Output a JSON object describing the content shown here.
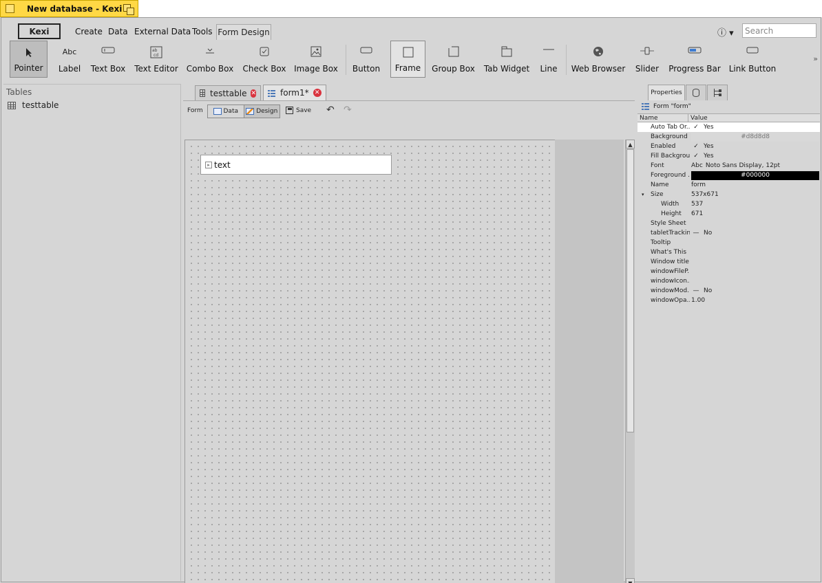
{
  "window": {
    "title": "New database - Kexi"
  },
  "menu": {
    "app_button": "Kexi",
    "tabs": [
      "Create",
      "Data",
      "External Data",
      "Tools",
      "Form Design"
    ],
    "search_placeholder": "Search"
  },
  "toolbar": {
    "tools": [
      {
        "label": "Pointer",
        "icon": "pointer-icon",
        "active": true
      },
      {
        "label": "Label",
        "icon": "label-abc-icon"
      },
      {
        "label": "Text Box",
        "icon": "textbox-icon"
      },
      {
        "label": "Text Editor",
        "icon": "text-editor-icon"
      },
      {
        "label": "Combo Box",
        "icon": "combobox-icon"
      },
      {
        "label": "Check Box",
        "icon": "checkbox-icon"
      },
      {
        "label": "Image Box",
        "icon": "image-icon"
      },
      {
        "label": "Button",
        "icon": "button-icon"
      },
      {
        "label": "Frame",
        "icon": "frame-icon",
        "highlighted": true
      },
      {
        "label": "Group Box",
        "icon": "groupbox-icon"
      },
      {
        "label": "Tab Widget",
        "icon": "tabwidget-icon"
      },
      {
        "label": "Line",
        "icon": "line-icon"
      },
      {
        "label": "Web Browser",
        "icon": "globe-icon"
      },
      {
        "label": "Slider",
        "icon": "slider-icon"
      },
      {
        "label": "Progress Bar",
        "icon": "progressbar-icon"
      },
      {
        "label": "Link Button",
        "icon": "link-button-icon"
      }
    ],
    "label_icon_text": "Abc",
    "more_glyph": "»"
  },
  "navigator": {
    "header": "Tables",
    "items": [
      {
        "label": "testtable",
        "icon": "table-grid-icon"
      }
    ]
  },
  "document_tabs": [
    {
      "label": "testtable",
      "icon": "table-grid-icon",
      "active": false
    },
    {
      "label": "form1*",
      "icon": "form-icon",
      "active": true
    }
  ],
  "view_toolbar": {
    "form_label": "Form",
    "data_label": "Data",
    "design_label": "Design",
    "save_label": "Save"
  },
  "form_canvas": {
    "widget_text": "text"
  },
  "properties": {
    "tabs": [
      "Properties"
    ],
    "object_title": "Form \"form\"",
    "col_name": "Name",
    "col_value": "Value",
    "rows": [
      {
        "name": "Auto Tab Or...",
        "check": "✓",
        "value": "Yes",
        "selected": true
      },
      {
        "name": "Background ...",
        "swatch": "#d8d8d8",
        "value": "#d8d8d8"
      },
      {
        "name": "Enabled",
        "check": "✓",
        "value": "Yes"
      },
      {
        "name": "Fill Backgrou...",
        "check": "✓",
        "value": "Yes"
      },
      {
        "name": "Font",
        "prefix": "Abc",
        "value": "Noto Sans Display, 12pt"
      },
      {
        "name": "Foreground ...",
        "swatch": "#000000",
        "value": "#000000"
      },
      {
        "name": "Name",
        "value": "form"
      },
      {
        "name": "Size",
        "value": "537x671",
        "expander": "▾"
      },
      {
        "name": "Width",
        "value": "537",
        "sub": true
      },
      {
        "name": "Height",
        "value": "671",
        "sub": true
      },
      {
        "name": "Style Sheet",
        "value": ""
      },
      {
        "name": "tabletTracking",
        "check": "—",
        "value": "No"
      },
      {
        "name": "Tooltip",
        "value": ""
      },
      {
        "name": "What's This",
        "value": ""
      },
      {
        "name": "Window title",
        "value": ""
      },
      {
        "name": "windowFileP...",
        "value": ""
      },
      {
        "name": "windowIcon...",
        "value": ""
      },
      {
        "name": "windowMod...",
        "check": "—",
        "value": "No"
      },
      {
        "name": "windowOpa...",
        "value": "1.00"
      }
    ]
  },
  "colors": {
    "title_tab": "#ffd845",
    "background": "#d6d6d6",
    "close_badge": "#d9343f"
  }
}
